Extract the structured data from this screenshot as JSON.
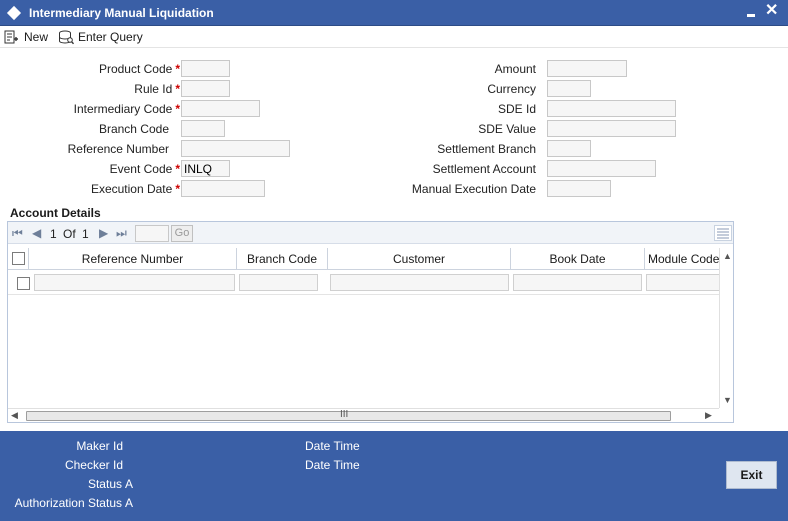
{
  "window": {
    "title": "Intermediary Manual Liquidation"
  },
  "toolbar": {
    "new_label": "New",
    "enter_query_label": "Enter Query"
  },
  "form": {
    "left": [
      {
        "label": "Product Code",
        "required": "*",
        "value": ""
      },
      {
        "label": "Rule Id",
        "required": "*",
        "value": ""
      },
      {
        "label": "Intermediary Code",
        "required": "*",
        "value": ""
      },
      {
        "label": "Branch Code",
        "required": "",
        "value": ""
      },
      {
        "label": "Reference Number",
        "required": "",
        "value": ""
      },
      {
        "label": "Event Code",
        "required": "*",
        "value": "INLQ"
      },
      {
        "label": "Execution Date",
        "required": "*",
        "value": ""
      }
    ],
    "right": [
      {
        "label": "Amount",
        "value": ""
      },
      {
        "label": "Currency",
        "value": ""
      },
      {
        "label": "SDE Id",
        "value": ""
      },
      {
        "label": "SDE Value",
        "value": ""
      },
      {
        "label": "Settlement Branch",
        "value": ""
      },
      {
        "label": "Settlement Account",
        "value": ""
      },
      {
        "label": "Manual Execution Date",
        "value": ""
      }
    ]
  },
  "account_details": {
    "title": "Account Details",
    "pager": {
      "current": "1",
      "of_label": "Of",
      "total": "1",
      "go_label": "Go"
    },
    "columns": [
      "Reference Number",
      "Branch Code",
      "Customer",
      "Book Date",
      "Module Code"
    ],
    "scroll_grip": "III"
  },
  "footer": {
    "maker_id_label": "Maker Id",
    "checker_id_label": "Checker Id",
    "date_time_label_1": "Date Time",
    "date_time_label_2": "Date Time",
    "status_label": "Status",
    "status_value": "A",
    "authorization_status_label": "Authorization Status",
    "authorization_status_value": "A",
    "exit_label": "Exit"
  },
  "colors": {
    "titlebar": "#3a5fa6",
    "footer": "#3a5fa6",
    "required": "#cc0000"
  }
}
